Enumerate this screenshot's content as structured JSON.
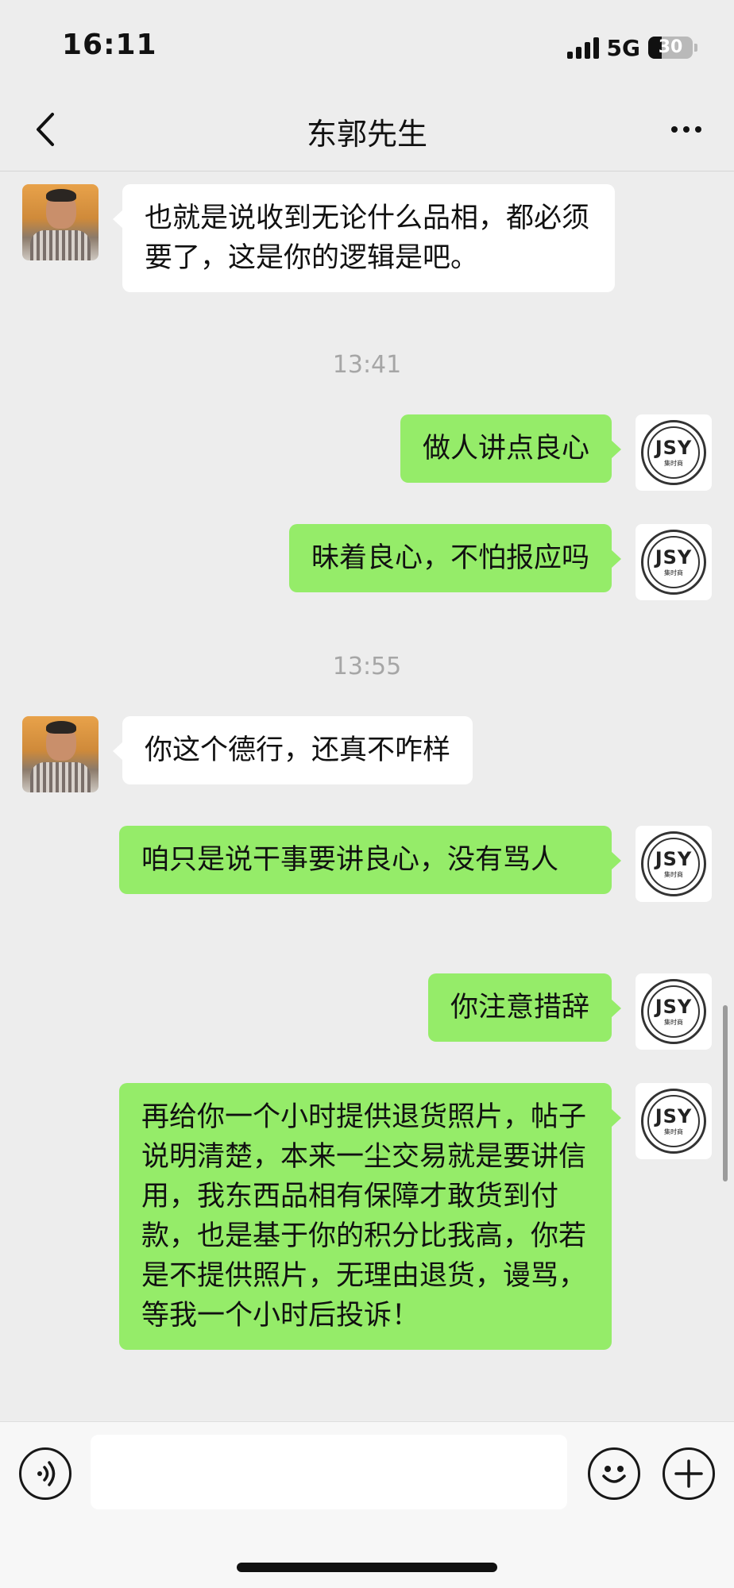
{
  "status_bar": {
    "time": "16:11",
    "network": "5G",
    "battery_percent": "30",
    "battery_level": 0.3
  },
  "nav": {
    "title": "东郭先生",
    "back_icon": "chevron-left-icon",
    "more_icon": "more-dots-icon"
  },
  "messages": [
    {
      "side": "left",
      "type": "text",
      "text": "也就是说收到无论什么品相，都必须要了，这是你的逻辑是吧。"
    },
    {
      "type": "timestamp",
      "text": "13:41"
    },
    {
      "side": "right",
      "type": "text",
      "text": "做人讲点良心"
    },
    {
      "side": "right",
      "type": "text",
      "text": "昧着良心，不怕报应吗"
    },
    {
      "type": "timestamp",
      "text": "13:55"
    },
    {
      "side": "left",
      "type": "text",
      "text": "你这个德行，还真不咋样"
    },
    {
      "side": "right",
      "type": "text",
      "text": "咱只是说干事要讲良心，没有骂人"
    },
    {
      "side": "right",
      "type": "text",
      "text": "你注意措辞"
    },
    {
      "side": "right",
      "type": "text",
      "text": "再给你一个小时提供退货照片，帖子说明清楚，本来一尘交易就是要讲信用，我东西品相有保障才敢货到付款，也是基于你的积分比我高，你若是不提供照片，无理由退货，谩骂，等我一个小时后投诉！"
    }
  ],
  "self_avatar": {
    "logo_text": "JSY",
    "logo_sub": "集时商"
  },
  "input_bar": {
    "value": "",
    "voice_icon": "voice-icon",
    "emoji_icon": "emoji-icon",
    "plus_icon": "plus-icon"
  },
  "colors": {
    "background": "#ededed",
    "bubble_self": "#95ec69",
    "bubble_other": "#ffffff",
    "timestamp": "#a6a6a6"
  }
}
